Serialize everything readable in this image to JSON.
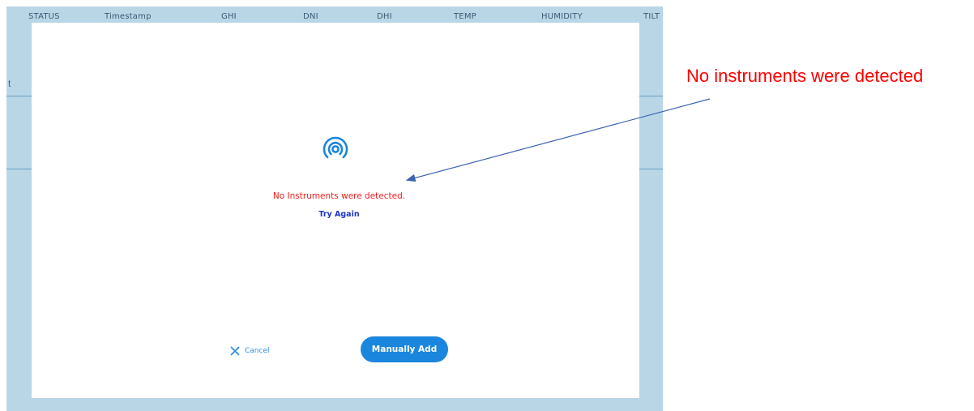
{
  "table": {
    "columns": [
      "STATUS",
      "Timestamp",
      "GHI",
      "DNI",
      "DHI",
      "TEMP",
      "HUMIDITY",
      "TILT"
    ],
    "row_fragment": "t"
  },
  "modal": {
    "icon": "signal-broadcast-icon",
    "error_message": "No Instruments were detected.",
    "retry_label": "Try Again",
    "cancel_label": "Cancel",
    "manual_add_label": "Manually Add"
  },
  "annotation": {
    "callout_text": "No instruments were detected"
  },
  "colors": {
    "background_app": "#b8d6e6",
    "error": "#ee1a1a",
    "link": "#1c35c8",
    "primary": "#1a86de",
    "callout": "#ff0000",
    "arrow": "#3c63b0"
  }
}
